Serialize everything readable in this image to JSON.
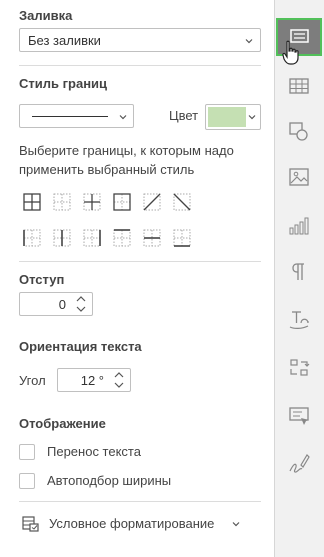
{
  "fill": {
    "title": "Заливка",
    "value": "Без заливки"
  },
  "borders": {
    "title": "Стиль границ",
    "color_label": "Цвет",
    "color_value": "#c5e0b3",
    "hint": "Выберите границы, к которым надо применить выбранный стиль"
  },
  "indent": {
    "title": "Отступ",
    "value": "0"
  },
  "orientation": {
    "title": "Ориентация текста",
    "angle_label": "Угол",
    "angle_value": "12 °"
  },
  "display": {
    "title": "Отображение",
    "wrap_label": "Перенос текста",
    "autofit_label": "Автоподбор ширины"
  },
  "conditional": {
    "label": "Условное форматирование"
  },
  "rightbar": {
    "items": [
      "cell-settings-icon",
      "table-icon",
      "shape-icon",
      "image-icon",
      "chart-icon",
      "paragraph-icon",
      "text-art-icon",
      "pivot-icon",
      "signature-icon",
      "form-icon"
    ]
  }
}
